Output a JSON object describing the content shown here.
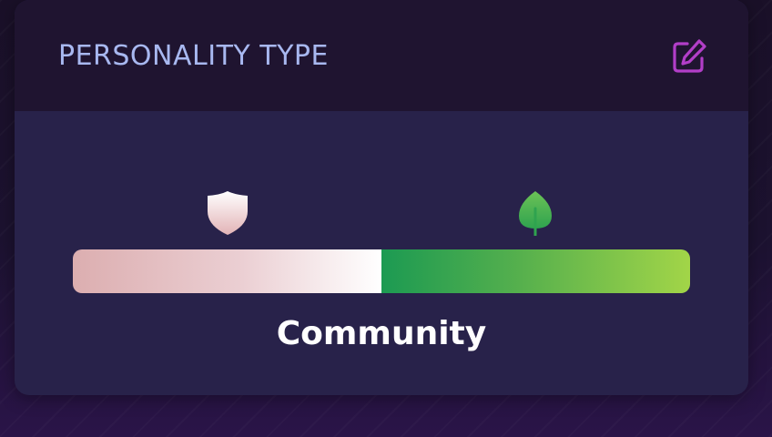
{
  "card": {
    "title": "PERSONALITY TYPE",
    "edit_icon": "edit-icon"
  },
  "scale": {
    "left_icon": "shield-icon",
    "right_icon": "leaf-icon",
    "left_share": 0.5,
    "right_share": 0.5,
    "colors": {
      "left_start": "#dcaeb0",
      "left_end": "#ffffff",
      "right_start": "#1c9a52",
      "right_end": "#a2d548"
    }
  },
  "result": {
    "label": "Community"
  },
  "theme": {
    "title_color": "#a8b8f0",
    "accent_color": "#b23ec8",
    "card_color": "#28224a"
  }
}
